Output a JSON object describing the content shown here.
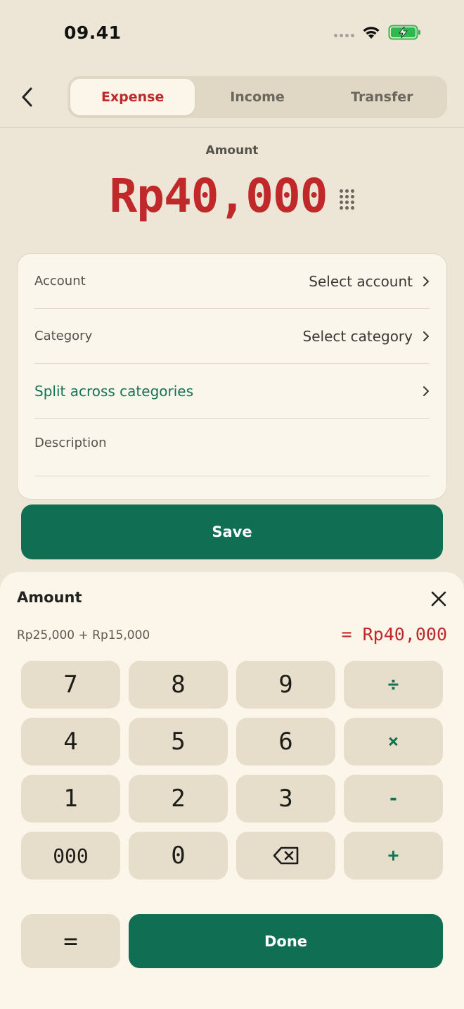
{
  "status_bar": {
    "time": "09.41"
  },
  "header": {
    "tabs": [
      {
        "label": "Expense",
        "active": true
      },
      {
        "label": "Income",
        "active": false
      },
      {
        "label": "Transfer",
        "active": false
      }
    ]
  },
  "amount": {
    "label": "Amount",
    "value": "Rp40,000"
  },
  "form": {
    "account_label": "Account",
    "account_value": "Select account",
    "category_label": "Category",
    "category_value": "Select category",
    "split_label": "Split across categories",
    "description_label": "Description"
  },
  "save_label": "Save",
  "calculator": {
    "title": "Amount",
    "expression": "Rp25,000 + Rp15,000",
    "result": "= Rp40,000",
    "keys": [
      "7",
      "8",
      "9",
      "÷",
      "4",
      "5",
      "6",
      "×",
      "1",
      "2",
      "3",
      "-",
      "000",
      "0",
      "backspace",
      "+"
    ],
    "equals_label": "=",
    "done_label": "Done"
  },
  "colors": {
    "background": "#ede6d6",
    "accent_red": "#c0282a",
    "accent_green": "#106e53",
    "key_bg": "#e6decb",
    "sheet_bg": "#fbf5ea"
  },
  "icons": [
    "back-arrow-icon",
    "wifi-icon",
    "battery-charging-icon",
    "keypad-icon",
    "chevron-right-icon",
    "close-icon",
    "backspace-icon"
  ]
}
